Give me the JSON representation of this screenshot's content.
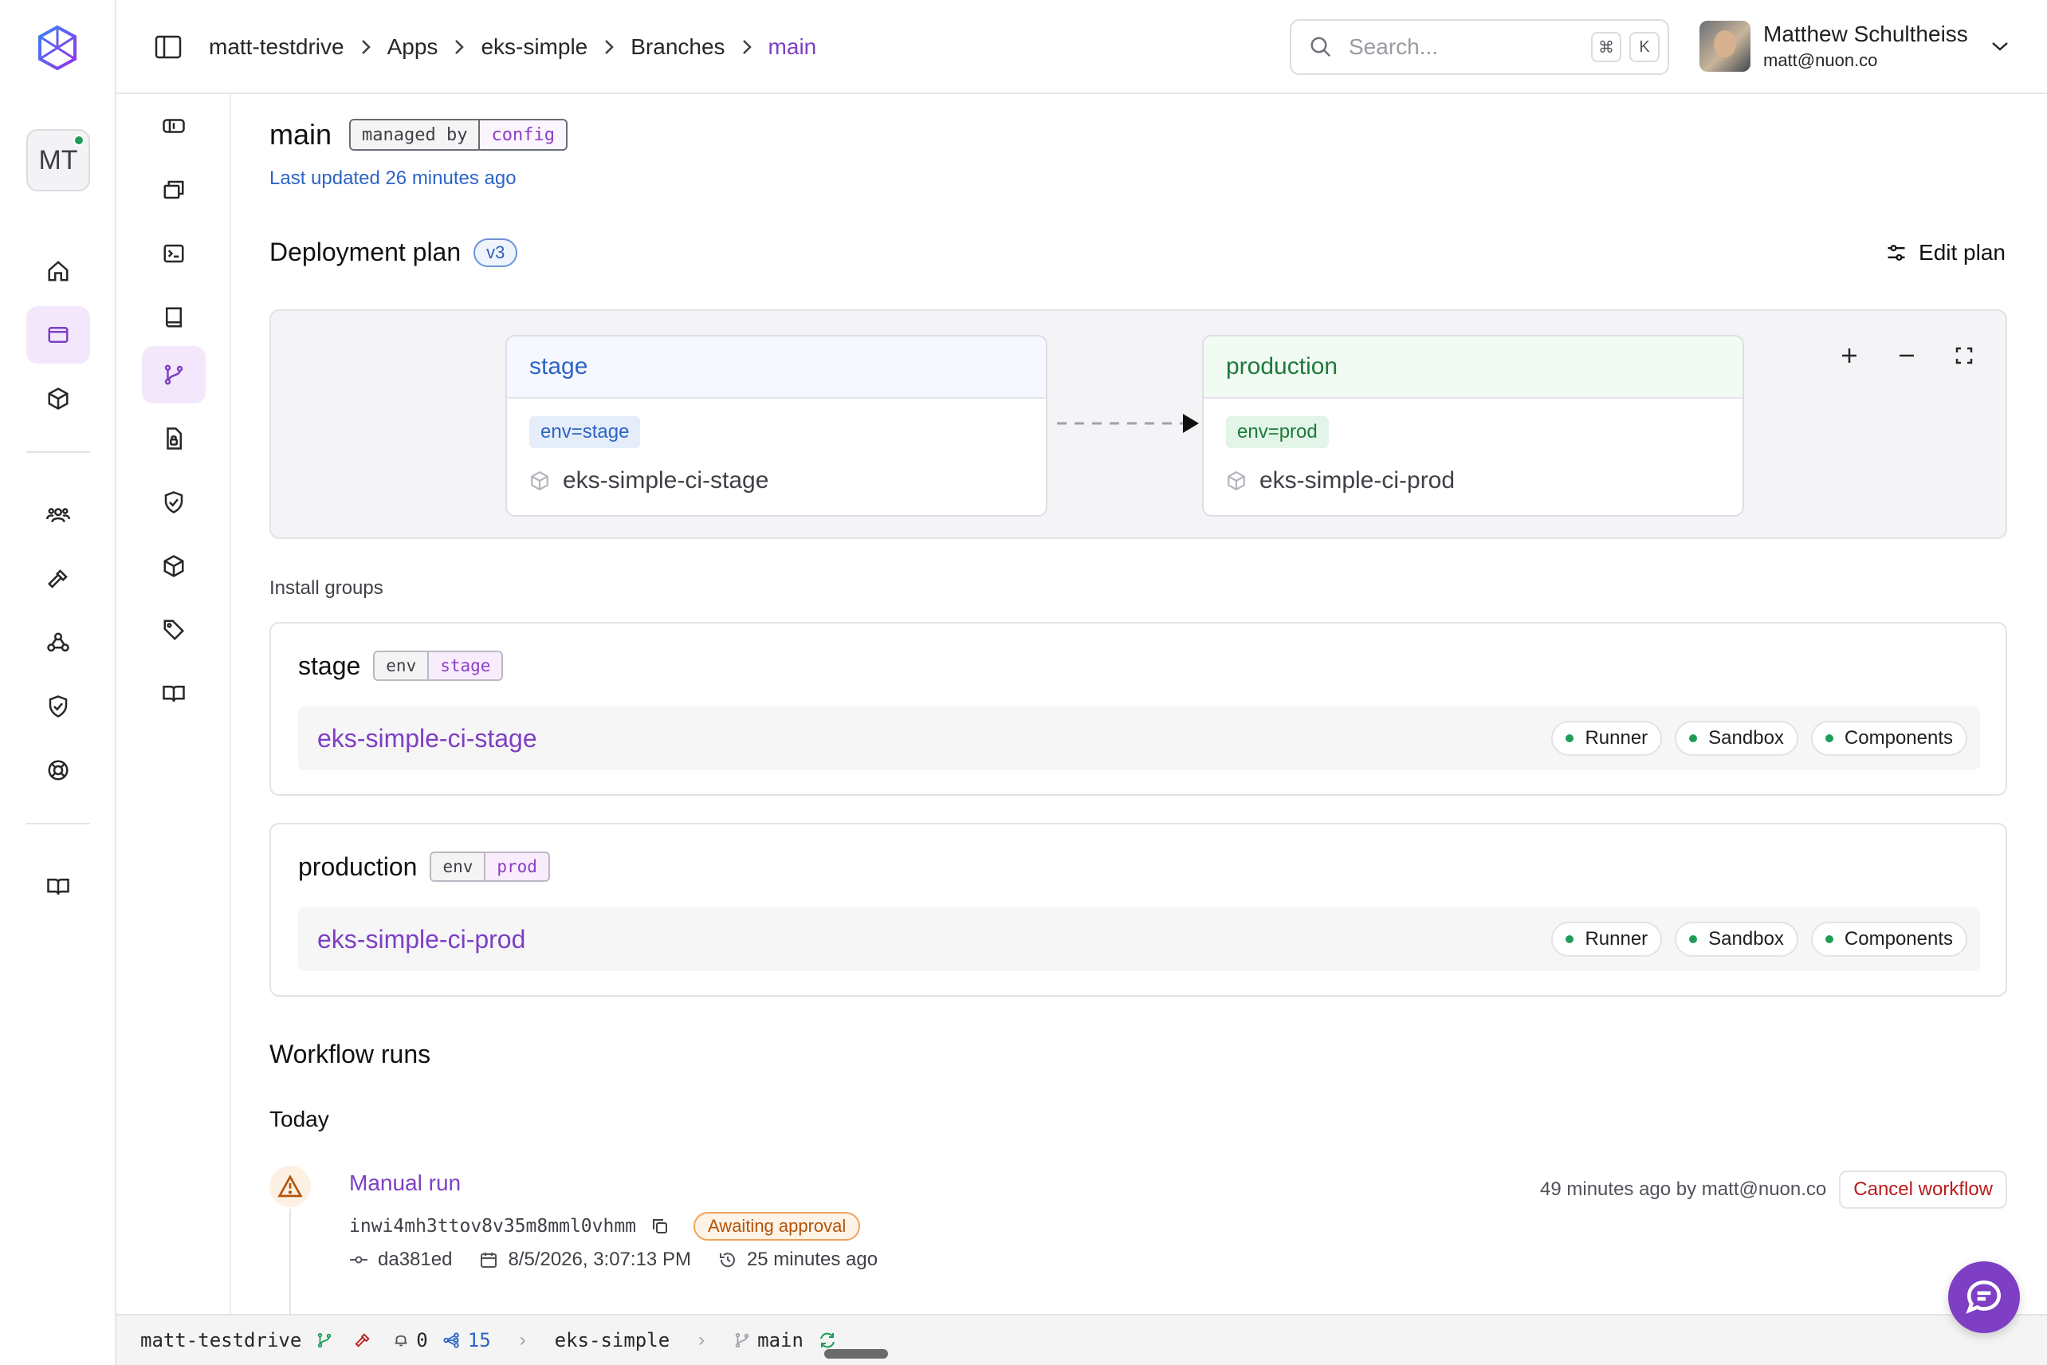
{
  "breadcrumbs": [
    "matt-testdrive",
    "Apps",
    "eks-simple",
    "Branches",
    "main"
  ],
  "search": {
    "placeholder": "Search...",
    "shortcut_mod": "⌘",
    "shortcut_key": "K"
  },
  "user": {
    "name": "Matthew Schultheiss",
    "email": "matt@nuon.co"
  },
  "org": {
    "initials": "MT"
  },
  "page": {
    "title": "main",
    "managed_key": "managed by",
    "managed_value": "config",
    "updated": "Last updated 26 minutes ago"
  },
  "plan": {
    "title": "Deployment plan",
    "version": "v3",
    "edit_label": "Edit plan",
    "nodes": [
      {
        "name": "stage",
        "tag": "env=stage",
        "install": "eks-simple-ci-stage"
      },
      {
        "name": "production",
        "tag": "env=prod",
        "install": "eks-simple-ci-prod"
      }
    ]
  },
  "install_groups": {
    "label": "Install groups",
    "groups": [
      {
        "name": "stage",
        "key": "env",
        "value": "stage",
        "install": "eks-simple-ci-stage",
        "statuses": [
          "Runner",
          "Sandbox",
          "Components"
        ]
      },
      {
        "name": "production",
        "key": "env",
        "value": "prod",
        "install": "eks-simple-ci-prod",
        "statuses": [
          "Runner",
          "Sandbox",
          "Components"
        ]
      }
    ]
  },
  "workflows": {
    "title": "Workflow runs",
    "day": "Today",
    "run": {
      "name": "Manual run",
      "id": "inwi4mh3ttov8v35m8mml0vhmm",
      "status": "Awaiting approval",
      "commit": "da381ed",
      "date": "8/5/2026, 3:07:13 PM",
      "elapsed": "25 minutes ago",
      "when": "49 minutes ago by matt@nuon.co",
      "cancel_label": "Cancel workflow"
    }
  },
  "statusbar": {
    "org": "matt-testdrive",
    "notifications": "0",
    "nodes": "15",
    "app": "eks-simple",
    "branch": "main"
  },
  "colors": {
    "accent": "#7e3fc4",
    "stage": "#2c64c7",
    "production": "#1e7a3c",
    "ok": "#1f9d55",
    "warning": "#b45309",
    "danger": "#b91c1c"
  }
}
